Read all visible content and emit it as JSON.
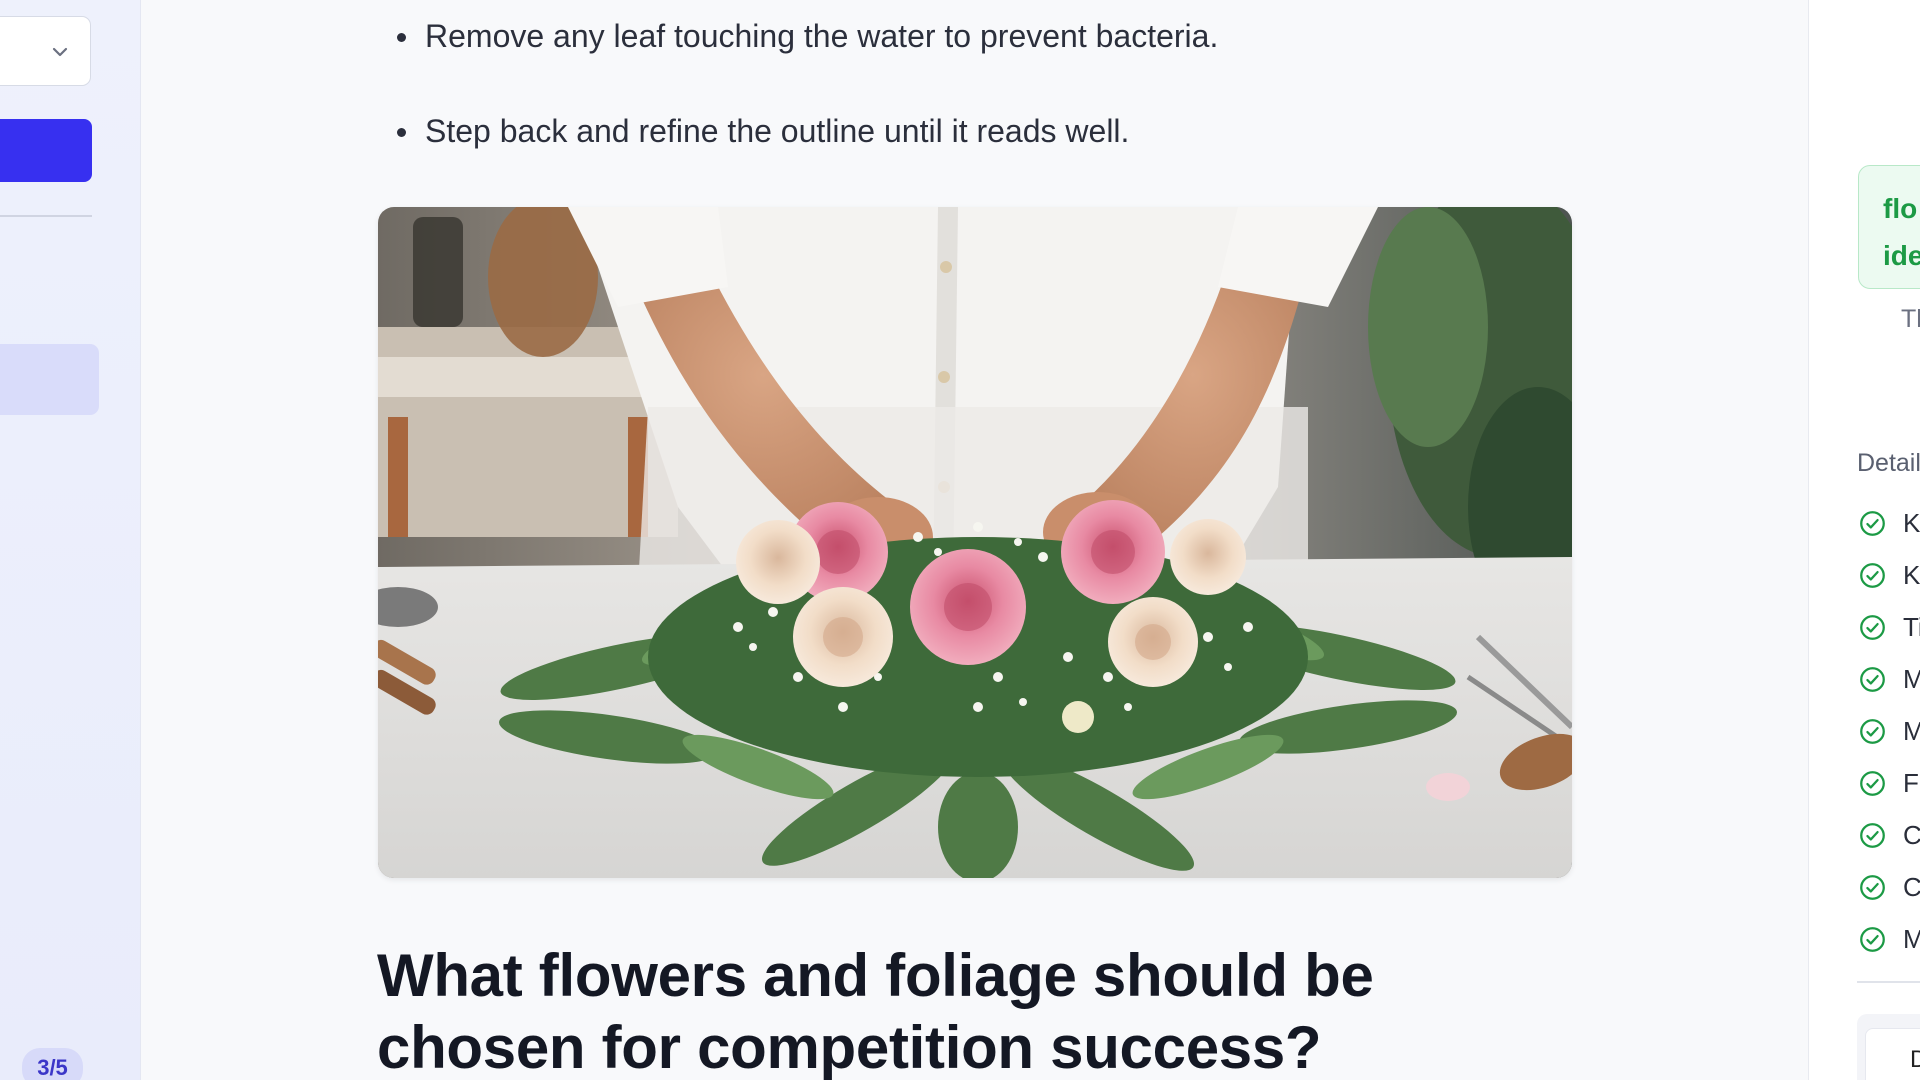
{
  "sidebar": {
    "select_chevron_icon": "chevron-down-icon",
    "pager": "3/5"
  },
  "article": {
    "bullets": [
      "Remove any leaf touching the water to prevent bacteria.",
      "Step back and refine the outline until it reads well."
    ],
    "heading": "What flowers and foliage should be chosen for competition success?"
  },
  "right_panel": {
    "tag_lines": [
      "flo",
      "ide"
    ],
    "desc": "Th",
    "details_label": "Detail",
    "items": [
      "Ke",
      "Ke",
      "Ti",
      "M",
      "M",
      "Fe",
      "C",
      "C",
      "M"
    ],
    "bottom_card_text": "D",
    "check_color": "#1c9a45"
  },
  "colors": {
    "accent": "#3730f0",
    "sidebar_bg": "#eef1fc",
    "active_item": "#d9dcfa",
    "success": "#1c9a45"
  }
}
